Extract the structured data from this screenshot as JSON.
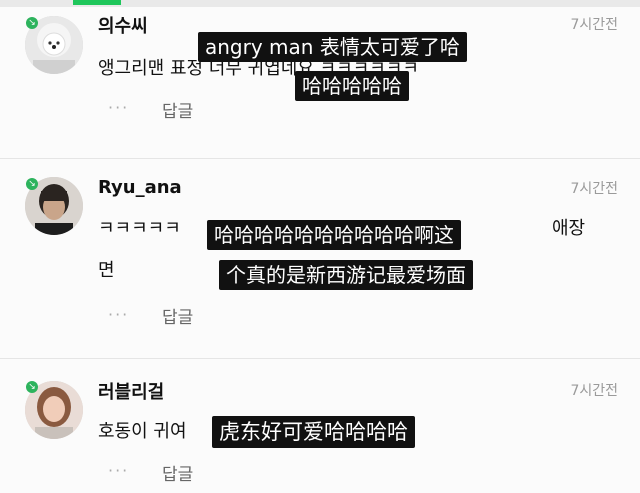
{
  "comments": [
    {
      "author": "의수씨",
      "time": "7시간전",
      "text": "앵그리맨 표정 너무 귀엽네요 ㅋㅋㅋㅋㅋㅋ",
      "more": "···",
      "reply": "답글",
      "subtitles": [
        "angry man 表情太可爱了哈",
        "哈哈哈哈哈"
      ]
    },
    {
      "author": "Ryu_ana",
      "time": "7시간전",
      "text_line1_start": "ㅋㅋㅋㅋㅋ",
      "text_line1_end": "애장",
      "text_line2": "면",
      "more": "···",
      "reply": "답글",
      "subtitles": [
        "哈哈哈哈哈哈哈哈哈哈啊这",
        "个真的是新西游记最爱场面"
      ]
    },
    {
      "author": "러블리걸",
      "time": "7시간전",
      "text": "호동이 귀여",
      "more": "···",
      "reply": "답글",
      "subtitles": [
        "虎东好可爱哈哈哈哈"
      ]
    }
  ],
  "colors": {
    "accent": "#1fc65b",
    "subtitle_bg": "#111111",
    "badge": "#2db35d"
  }
}
